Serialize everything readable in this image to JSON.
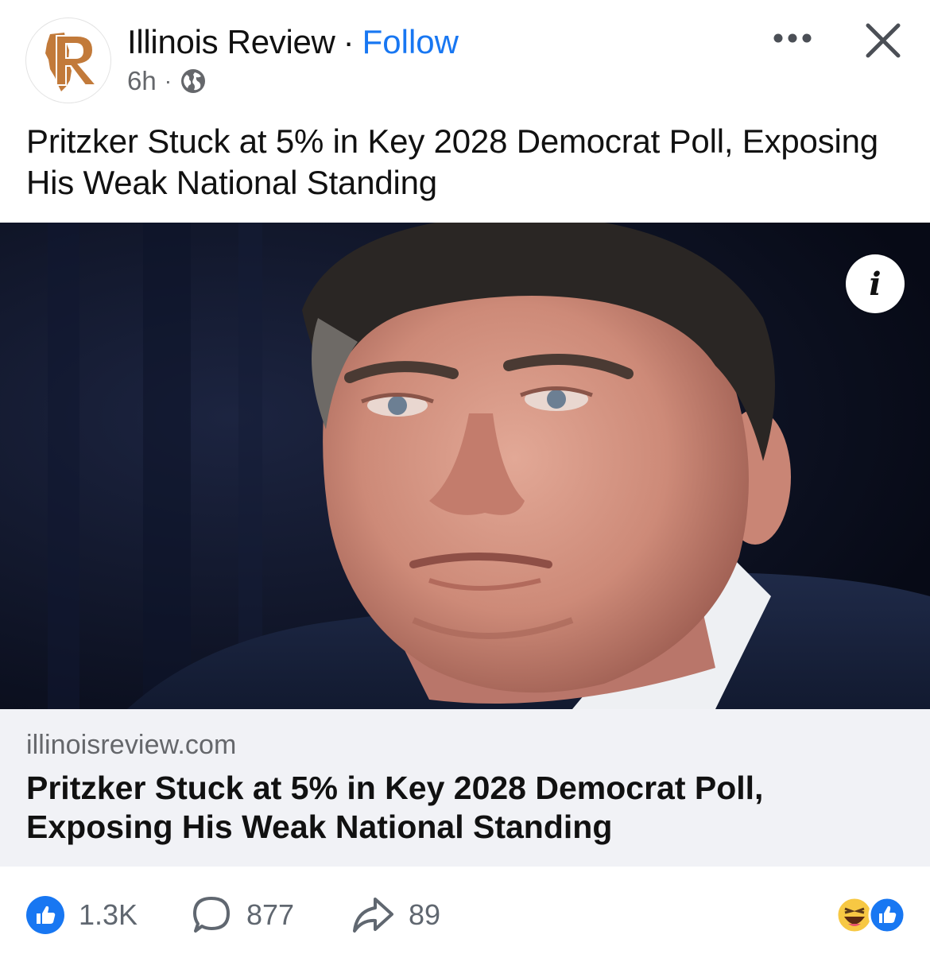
{
  "header": {
    "page_name": "Illinois Review",
    "separator": "·",
    "follow_label": "Follow",
    "timestamp": "6h",
    "meta_separator": "·",
    "privacy_icon": "globe-icon",
    "more_icon": "more-horizontal-icon",
    "close_icon": "close-icon",
    "avatar_logo": "R"
  },
  "caption": {
    "text": "Pritzker Stuck at 5% in Key 2028 Democrat Poll, Exposing His Weak National Standing"
  },
  "media": {
    "info_icon": "i",
    "image_alt": "photo of a man in a dark suit"
  },
  "link_preview": {
    "domain": "illinoisreview.com",
    "title": "Pritzker Stuck at 5% in Key 2028 Democrat Poll, Exposing His Weak National Standing"
  },
  "footer": {
    "likes": "1.3K",
    "comments": "877",
    "shares": "89",
    "like_icon": "thumbs-up-icon",
    "comment_icon": "comment-icon",
    "share_icon": "share-arrow-icon",
    "reaction_icons": [
      "haha-emoji-icon",
      "like-reaction-icon"
    ]
  },
  "colors": {
    "accent": "#1877f2",
    "logo": "#c27a3a",
    "muted": "#65676b",
    "link_bg": "#f1f2f6"
  }
}
